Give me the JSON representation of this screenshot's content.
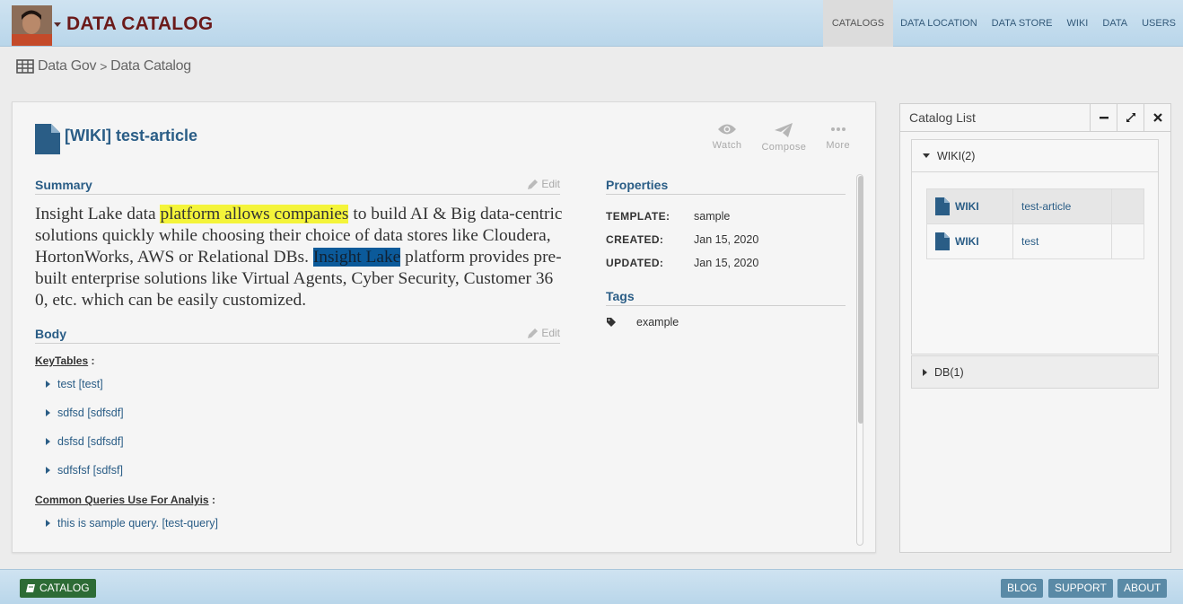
{
  "header": {
    "brand": "DATA CATALOG",
    "nav": [
      "CATALOGS",
      "DATA LOCATION",
      "DATA STORE",
      "WIKI",
      "DATA",
      "USERS"
    ],
    "active_nav": "CATALOGS"
  },
  "breadcrumb": {
    "root": "Data Gov",
    "sep": ">",
    "current": "Data Catalog"
  },
  "article": {
    "title": "[WIKI] test-article",
    "actions": {
      "watch": "Watch",
      "compose": "Compose",
      "more": "More"
    },
    "summary_heading": "Summary",
    "body_heading": "Body",
    "edit_label": "Edit",
    "summary": {
      "pre": "Insight Lake data ",
      "highlight1": "platform allows companies",
      "mid": " to build AI & Big data-centric solutions quickly while choosing their choice of data stores like Cloudera, HortonWorks, AWS or Relational DBs. ",
      "highlight2": "Insight Lake",
      "post": " platform provides pre-built enterprise solutions like Virtual Agents, Cyber Security, Customer 360, etc. which can be easily customized."
    },
    "key_tables_label": "KeyTables",
    "key_tables": [
      "test [test]",
      "sdfsd [sdfsdf]",
      "dsfsd [sdfsdf]",
      "sdfsfsf [sdfsf]"
    ],
    "queries_label": "Common Queries Use For Analyis",
    "queries": [
      "this is sample query. [test-query]"
    ],
    "properties_heading": "Properties",
    "properties": [
      {
        "k": "TEMPLATE:",
        "v": "sample"
      },
      {
        "k": "CREATED:",
        "v": "Jan 15, 2020"
      },
      {
        "k": "UPDATED:",
        "v": "Jan 15, 2020"
      }
    ],
    "tags_heading": "Tags",
    "tags": [
      "example"
    ]
  },
  "catalog_list": {
    "title": "Catalog List",
    "groups": [
      {
        "label": "WIKI(2)",
        "rows": [
          {
            "type": "WIKI",
            "name": "test-article"
          },
          {
            "type": "WIKI",
            "name": "test"
          }
        ]
      },
      {
        "label": "DB(1)"
      }
    ]
  },
  "footer": {
    "catalog": "CATALOG",
    "blog": "BLOG",
    "support": "SUPPORT",
    "about": "ABOUT"
  }
}
